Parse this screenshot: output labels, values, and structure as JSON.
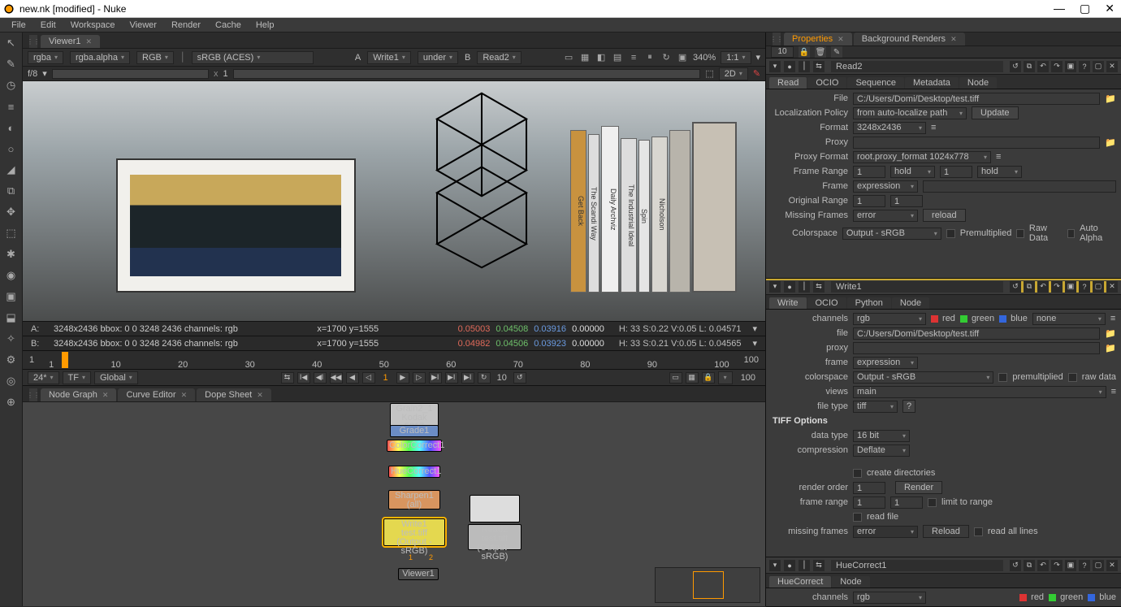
{
  "window": {
    "title": "new.nk [modified] - Nuke"
  },
  "menu": [
    "File",
    "Edit",
    "Workspace",
    "Viewer",
    "Render",
    "Cache",
    "Help"
  ],
  "viewer_tab": "Viewer1",
  "viewer_bar": {
    "ch1": "rgba",
    "ch2": "rgba.alpha",
    "ch3": "RGB",
    "ch4": "sRGB (ACES)",
    "a_label": "A",
    "a_node": "Write1",
    "blend": "under",
    "b_label": "B",
    "b_node": "Read2",
    "zoom": "340%",
    "scale": "1:1"
  },
  "ruler": {
    "f": "f/8",
    "xlabel": "x",
    "xval": "1",
    "dim_label": "2D"
  },
  "info_a": {
    "label": "A:",
    "dim": "3248x2436  bbox: 0 0 3248 2436 channels: rgb",
    "xy": "x=1700 y=1555",
    "r": "0.05003",
    "g": "0.04508",
    "b": "0.03916",
    "a2": "0.00000",
    "hsv": "H: 33 S:0.22 V:0.05  L: 0.04571"
  },
  "info_b": {
    "label": "B:",
    "dim": "3248x2436  bbox: 0 0 3248 2436 channels: rgb",
    "xy": "x=1700 y=1555",
    "r": "0.04982",
    "g": "0.04506",
    "b": "0.03923",
    "a2": "0.00000",
    "hsv": "H: 33 S:0.21 V:0.05  L: 0.04565"
  },
  "timeline": {
    "start": "1",
    "end": "100",
    "cur": "1",
    "ticks": [
      "1",
      "10",
      "20",
      "30",
      "40",
      "50",
      "60",
      "70",
      "80",
      "90",
      "100"
    ]
  },
  "playbar": {
    "fps": "24*",
    "mode": "TF",
    "scope": "Global",
    "in": "1",
    "out": "10",
    "end": "100"
  },
  "bottom_tabs": [
    "Node Graph",
    "Curve Editor",
    "Dope Sheet"
  ],
  "nodes": {
    "grain": "Grain2_1\nKodak 5217",
    "grade": "Grade1",
    "cc": "ColorCorrect1",
    "hue": "HueCorrect1",
    "sharpen": "Sharpen1\n(all)",
    "write": "Write1\ntest.tiff\n(Output - sRGB)",
    "read": "Read2\ntest.tiff\n(Output - sRGB)",
    "viewer": "Viewer1"
  },
  "prop_tabs": [
    "Properties",
    "Background Renders"
  ],
  "prop_count": "10",
  "read2": {
    "title": "Read2",
    "tabs": [
      "Read",
      "OCIO",
      "Sequence",
      "Metadata",
      "Node"
    ],
    "file_lbl": "File",
    "file": "C:/Users/Domi/Desktop/test.tiff",
    "locpol_lbl": "Localization Policy",
    "locpol": "from auto-localize path",
    "update": "Update",
    "format_lbl": "Format",
    "format": "3248x2436",
    "proxy_lbl": "Proxy",
    "proxyfmt_lbl": "Proxy Format",
    "proxyfmt": "root.proxy_format 1024x778",
    "framerange_lbl": "Frame Range",
    "fr1": "1",
    "hold1": "hold",
    "fr2": "1",
    "hold2": "hold",
    "frame_lbl": "Frame",
    "frame": "expression",
    "origrange_lbl": "Original Range",
    "or1": "1",
    "or2": "1",
    "missing_lbl": "Missing Frames",
    "missing": "error",
    "reload": "reload",
    "colorspace_lbl": "Colorspace",
    "colorspace": "Output - sRGB",
    "premult": "Premultiplied",
    "rawdata": "Raw Data",
    "autoalpha": "Auto Alpha"
  },
  "write1": {
    "title": "Write1",
    "tabs": [
      "Write",
      "OCIO",
      "Python",
      "Node"
    ],
    "channels_lbl": "channels",
    "channels": "rgb",
    "none": "none",
    "red": "red",
    "green": "green",
    "blue": "blue",
    "file_lbl": "file",
    "file": "C:/Users/Domi/Desktop/test.tiff",
    "proxy_lbl": "proxy",
    "frame_lbl": "frame",
    "frame": "expression",
    "colorspace_lbl": "colorspace",
    "colorspace": "Output - sRGB",
    "premult": "premultiplied",
    "rawdata": "raw data",
    "views_lbl": "views",
    "views": "main",
    "filetype_lbl": "file type",
    "filetype": "tiff",
    "q": "?",
    "section": "TIFF Options",
    "datatype_lbl": "data type",
    "datatype": "16 bit",
    "compression_lbl": "compression",
    "compression": "Deflate",
    "createdir": "create directories",
    "renderorder_lbl": "render order",
    "renderorder": "1",
    "render_btn": "Render",
    "framerange_lbl": "frame range",
    "fr1": "1",
    "fr2": "1",
    "limit": "limit to range",
    "readfile": "read file",
    "missing_lbl": "missing frames",
    "missing": "error",
    "reload_btn": "Reload",
    "readall": "read all lines"
  },
  "huec": {
    "title": "HueCorrect1",
    "tabs": [
      "HueCorrect",
      "Node"
    ],
    "channels_lbl": "channels",
    "channels": "rgb",
    "red": "red",
    "green": "green",
    "blue": "blue"
  }
}
